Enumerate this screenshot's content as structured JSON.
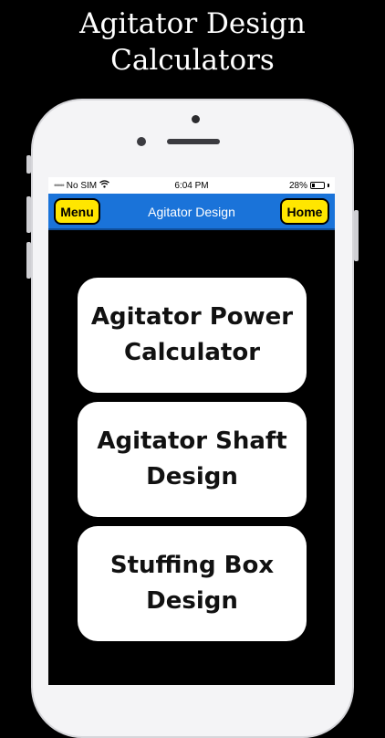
{
  "promo": {
    "title_line1": "Agitator Design",
    "title_line2": "Calculators"
  },
  "status_bar": {
    "carrier": "No SIM",
    "signal_dots": "•••••",
    "time": "6:04 PM",
    "battery_percent": "28%",
    "battery_level": 0.28
  },
  "nav": {
    "menu_label": "Menu",
    "title": "Agitator Design",
    "home_label": "Home"
  },
  "cards": [
    {
      "line1": "Agitator Power",
      "line2": "Calculator"
    },
    {
      "line1": "Agitator Shaft",
      "line2": "Design"
    },
    {
      "line1": "Stuffing Box",
      "line2": "Design"
    }
  ],
  "colors": {
    "nav_blue": "#1a73d9",
    "button_yellow": "#ffe600",
    "background": "#000000",
    "card": "#ffffff"
  }
}
